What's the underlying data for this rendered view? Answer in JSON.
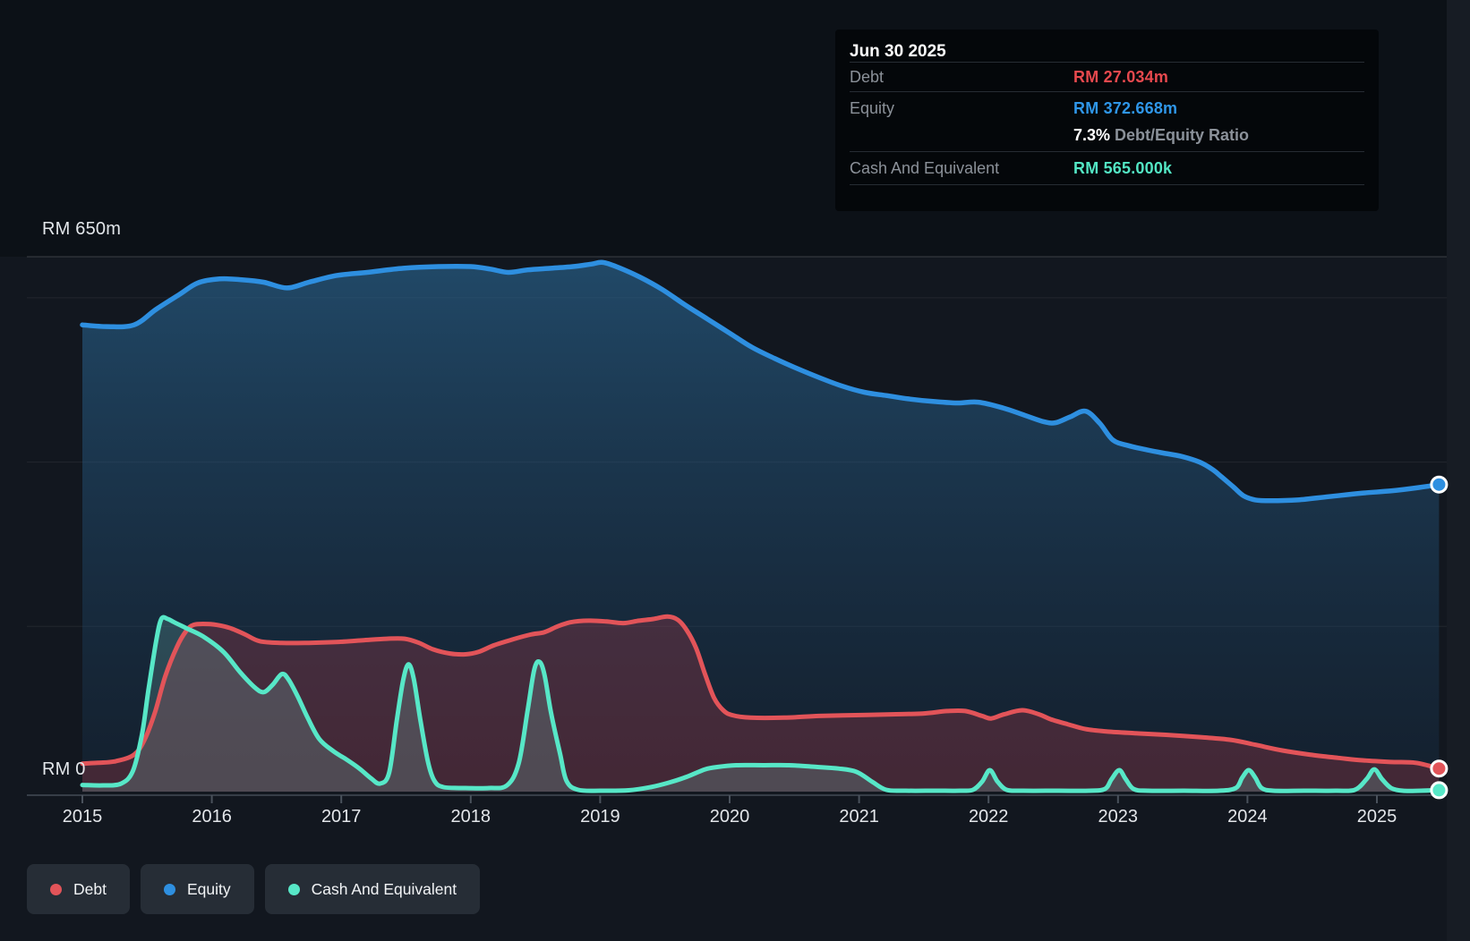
{
  "tooltip": {
    "date": "Jun 30 2025",
    "debt_label": "Debt",
    "debt_value": "RM 27.034m",
    "equity_label": "Equity",
    "equity_value": "RM 372.668m",
    "ratio_value": "7.3%",
    "ratio_label": "Debt/Equity Ratio",
    "cash_label": "Cash And Equivalent",
    "cash_value": "RM 565.000k",
    "colors": {
      "debt": "#e8494e",
      "equity": "#2f96e8",
      "cash": "#53e6c4"
    }
  },
  "axis": {
    "y_max_label": "RM 650m",
    "y_zero_label": "RM 0",
    "x_ticks": [
      "2015",
      "2016",
      "2017",
      "2018",
      "2019",
      "2020",
      "2021",
      "2022",
      "2023",
      "2024",
      "2025"
    ]
  },
  "legend": [
    {
      "label": "Debt",
      "color": "#e25459"
    },
    {
      "label": "Equity",
      "color": "#2e8fe0"
    },
    {
      "label": "Cash And Equivalent",
      "color": "#57e7c7"
    }
  ],
  "chart_data": {
    "type": "area",
    "x_unit": "year",
    "xlim": [
      2015.0,
      2025.5
    ],
    "ylim": [
      0,
      650
    ],
    "y_unit": "RM millions",
    "y_top_gridline": 650,
    "gridlines_m": [
      600,
      400,
      200
    ],
    "grid": true,
    "legend_position": "bottom-left",
    "last_point_date": "Jun 30 2025",
    "series": [
      {
        "name": "Equity",
        "color": "#2e8fe0",
        "fill_top": "rgba(43,106,152,0.60)",
        "fill_bottom": "rgba(24,52,80,0.30)",
        "end_value_label": "RM 372.668m",
        "points": [
          [
            2015.0,
            567
          ],
          [
            2015.19,
            565
          ],
          [
            2015.4,
            567
          ],
          [
            2015.57,
            586
          ],
          [
            2015.75,
            604
          ],
          [
            2015.89,
            618
          ],
          [
            2016.06,
            623
          ],
          [
            2016.23,
            622
          ],
          [
            2016.4,
            619
          ],
          [
            2016.58,
            612
          ],
          [
            2016.75,
            619
          ],
          [
            2016.96,
            627
          ],
          [
            2017.2,
            631
          ],
          [
            2017.48,
            636
          ],
          [
            2017.75,
            638
          ],
          [
            2018.0,
            638
          ],
          [
            2018.15,
            635
          ],
          [
            2018.29,
            631
          ],
          [
            2018.44,
            634
          ],
          [
            2018.62,
            636
          ],
          [
            2018.79,
            638
          ],
          [
            2018.93,
            641
          ],
          [
            2019.02,
            643
          ],
          [
            2019.14,
            637
          ],
          [
            2019.31,
            625
          ],
          [
            2019.48,
            610
          ],
          [
            2019.65,
            592
          ],
          [
            2019.83,
            574
          ],
          [
            2020.0,
            557
          ],
          [
            2020.17,
            540
          ],
          [
            2020.35,
            526
          ],
          [
            2020.52,
            514
          ],
          [
            2020.69,
            503
          ],
          [
            2020.86,
            493
          ],
          [
            2021.04,
            485
          ],
          [
            2021.21,
            481
          ],
          [
            2021.38,
            477
          ],
          [
            2021.56,
            474
          ],
          [
            2021.76,
            472
          ],
          [
            2021.92,
            473
          ],
          [
            2022.11,
            466
          ],
          [
            2022.28,
            457
          ],
          [
            2022.43,
            449
          ],
          [
            2022.52,
            448
          ],
          [
            2022.63,
            455
          ],
          [
            2022.75,
            462
          ],
          [
            2022.86,
            447
          ],
          [
            2022.96,
            427
          ],
          [
            2023.08,
            420
          ],
          [
            2023.22,
            415
          ],
          [
            2023.35,
            411
          ],
          [
            2023.49,
            407
          ],
          [
            2023.63,
            400
          ],
          [
            2023.73,
            391
          ],
          [
            2023.8,
            382
          ],
          [
            2023.89,
            370
          ],
          [
            2023.97,
            359
          ],
          [
            2024.06,
            354
          ],
          [
            2024.18,
            353
          ],
          [
            2024.39,
            354
          ],
          [
            2024.63,
            358
          ],
          [
            2024.87,
            362
          ],
          [
            2025.11,
            365
          ],
          [
            2025.32,
            369
          ],
          [
            2025.48,
            372.7
          ]
        ]
      },
      {
        "name": "Debt",
        "color": "#e25459",
        "fill": "rgba(190,60,75,0.28)",
        "end_value_label": "RM 27.034m",
        "points": [
          [
            2015.0,
            33
          ],
          [
            2015.12,
            34
          ],
          [
            2015.26,
            36
          ],
          [
            2015.4,
            44
          ],
          [
            2015.48,
            62
          ],
          [
            2015.56,
            95
          ],
          [
            2015.64,
            139
          ],
          [
            2015.73,
            175
          ],
          [
            2015.8,
            194
          ],
          [
            2015.86,
            202
          ],
          [
            2015.97,
            203
          ],
          [
            2016.07,
            201
          ],
          [
            2016.16,
            197
          ],
          [
            2016.26,
            190
          ],
          [
            2016.37,
            182
          ],
          [
            2016.54,
            180
          ],
          [
            2016.75,
            180
          ],
          [
            2016.96,
            181
          ],
          [
            2017.16,
            183
          ],
          [
            2017.35,
            185
          ],
          [
            2017.49,
            185
          ],
          [
            2017.6,
            180
          ],
          [
            2017.71,
            172
          ],
          [
            2017.84,
            167
          ],
          [
            2017.96,
            166
          ],
          [
            2018.06,
            169
          ],
          [
            2018.18,
            177
          ],
          [
            2018.32,
            184
          ],
          [
            2018.46,
            190
          ],
          [
            2018.57,
            193
          ],
          [
            2018.67,
            200
          ],
          [
            2018.77,
            205
          ],
          [
            2018.91,
            207
          ],
          [
            2019.05,
            206
          ],
          [
            2019.18,
            204
          ],
          [
            2019.3,
            207
          ],
          [
            2019.41,
            209
          ],
          [
            2019.52,
            212
          ],
          [
            2019.6,
            208
          ],
          [
            2019.67,
            195
          ],
          [
            2019.74,
            174
          ],
          [
            2019.81,
            142
          ],
          [
            2019.88,
            113
          ],
          [
            2019.95,
            98
          ],
          [
            2020.02,
            92
          ],
          [
            2020.16,
            89
          ],
          [
            2020.42,
            89
          ],
          [
            2020.69,
            91
          ],
          [
            2020.97,
            92
          ],
          [
            2021.25,
            93
          ],
          [
            2021.49,
            94
          ],
          [
            2021.68,
            97
          ],
          [
            2021.82,
            97
          ],
          [
            2021.95,
            91
          ],
          [
            2022.02,
            88
          ],
          [
            2022.12,
            93
          ],
          [
            2022.26,
            98
          ],
          [
            2022.39,
            93
          ],
          [
            2022.48,
            87
          ],
          [
            2022.61,
            81
          ],
          [
            2022.75,
            75
          ],
          [
            2022.92,
            72
          ],
          [
            2023.13,
            70
          ],
          [
            2023.37,
            68
          ],
          [
            2023.65,
            65
          ],
          [
            2023.87,
            62
          ],
          [
            2024.06,
            56
          ],
          [
            2024.27,
            49
          ],
          [
            2024.48,
            44
          ],
          [
            2024.7,
            40
          ],
          [
            2024.89,
            37
          ],
          [
            2025.11,
            35
          ],
          [
            2025.3,
            34
          ],
          [
            2025.48,
            27.0
          ]
        ]
      },
      {
        "name": "Cash And Equivalent",
        "color": "#57e7c7",
        "fill": "rgba(125,195,185,0.22)",
        "end_value_label": "RM 565.000k",
        "points": [
          [
            2015.0,
            7
          ],
          [
            2015.16,
            6.5
          ],
          [
            2015.3,
            8.7
          ],
          [
            2015.39,
            24
          ],
          [
            2015.46,
            68
          ],
          [
            2015.51,
            122
          ],
          [
            2015.57,
            182
          ],
          [
            2015.61,
            209
          ],
          [
            2015.66,
            209
          ],
          [
            2015.71,
            205
          ],
          [
            2015.8,
            198
          ],
          [
            2015.93,
            188
          ],
          [
            2016.09,
            169
          ],
          [
            2016.22,
            144
          ],
          [
            2016.33,
            126
          ],
          [
            2016.4,
            120
          ],
          [
            2016.47,
            129
          ],
          [
            2016.54,
            142
          ],
          [
            2016.59,
            136
          ],
          [
            2016.66,
            116
          ],
          [
            2016.74,
            89
          ],
          [
            2016.83,
            63
          ],
          [
            2016.94,
            48
          ],
          [
            2017.04,
            38
          ],
          [
            2017.14,
            27
          ],
          [
            2017.23,
            15
          ],
          [
            2017.3,
            8.7
          ],
          [
            2017.37,
            22
          ],
          [
            2017.43,
            87
          ],
          [
            2017.48,
            136
          ],
          [
            2017.52,
            154
          ],
          [
            2017.56,
            136
          ],
          [
            2017.61,
            87
          ],
          [
            2017.67,
            35
          ],
          [
            2017.72,
            12
          ],
          [
            2017.79,
            4.4
          ],
          [
            2017.96,
            3.3
          ],
          [
            2018.14,
            3.3
          ],
          [
            2018.28,
            6.5
          ],
          [
            2018.37,
            33
          ],
          [
            2018.44,
            98
          ],
          [
            2018.49,
            147
          ],
          [
            2018.53,
            157
          ],
          [
            2018.57,
            141
          ],
          [
            2018.62,
            95
          ],
          [
            2018.69,
            45
          ],
          [
            2018.74,
            12
          ],
          [
            2018.83,
            1.1
          ],
          [
            2019.01,
            0
          ],
          [
            2019.22,
            0.5
          ],
          [
            2019.39,
            4.4
          ],
          [
            2019.53,
            9.8
          ],
          [
            2019.67,
            17
          ],
          [
            2019.81,
            26
          ],
          [
            2019.91,
            29
          ],
          [
            2020.05,
            31
          ],
          [
            2020.26,
            31
          ],
          [
            2020.46,
            31
          ],
          [
            2020.67,
            29
          ],
          [
            2020.84,
            27
          ],
          [
            2020.98,
            23
          ],
          [
            2021.1,
            11
          ],
          [
            2021.21,
            1.1
          ],
          [
            2021.36,
            0
          ],
          [
            2021.59,
            0
          ],
          [
            2021.78,
            0
          ],
          [
            2021.88,
            1.1
          ],
          [
            2021.95,
            11
          ],
          [
            2022.01,
            25
          ],
          [
            2022.07,
            11
          ],
          [
            2022.14,
            1.1
          ],
          [
            2022.26,
            0
          ],
          [
            2022.54,
            0
          ],
          [
            2022.78,
            0
          ],
          [
            2022.9,
            2.2
          ],
          [
            2022.95,
            14
          ],
          [
            2023.01,
            25
          ],
          [
            2023.06,
            14
          ],
          [
            2023.12,
            2.2
          ],
          [
            2023.23,
            0
          ],
          [
            2023.51,
            0
          ],
          [
            2023.78,
            0
          ],
          [
            2023.91,
            3.3
          ],
          [
            2023.96,
            16
          ],
          [
            2024.01,
            25
          ],
          [
            2024.06,
            16
          ],
          [
            2024.11,
            3.3
          ],
          [
            2024.2,
            0
          ],
          [
            2024.44,
            0
          ],
          [
            2024.68,
            0
          ],
          [
            2024.83,
            1.1
          ],
          [
            2024.92,
            14
          ],
          [
            2024.98,
            26
          ],
          [
            2025.04,
            14
          ],
          [
            2025.11,
            3.3
          ],
          [
            2025.2,
            0
          ],
          [
            2025.34,
            0
          ],
          [
            2025.48,
            0.6
          ]
        ]
      }
    ]
  }
}
